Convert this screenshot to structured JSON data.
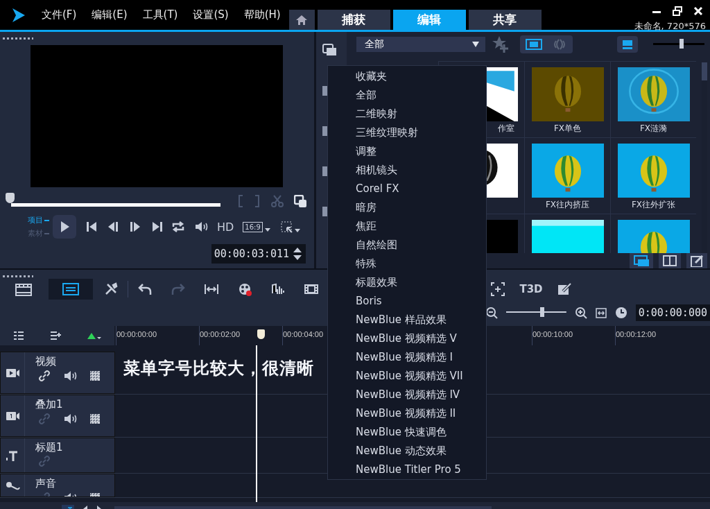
{
  "app_menu": [
    "文件(F)",
    "编辑(E)",
    "工具(T)",
    "设置(S)",
    "帮助(H)"
  ],
  "tabs": [
    {
      "kind": "home",
      "selected": false
    },
    {
      "kind": "text",
      "label": "捕获",
      "selected": false
    },
    {
      "kind": "text",
      "label": "编辑",
      "selected": true
    },
    {
      "kind": "text",
      "label": "共享",
      "selected": false
    }
  ],
  "project_info": "未命名, 720*576",
  "player": {
    "level": 0,
    "modes": [
      {
        "label": "项目",
        "selected": true
      },
      {
        "label": "素材",
        "selected": false
      }
    ],
    "quality": "HD",
    "aspect": "16:9",
    "timecode": "00:00:03:011"
  },
  "library": {
    "category": "全部",
    "zoom": {
      "level": 0.55
    },
    "items": [
      {
        "kind": "studio",
        "caption": "作室"
      },
      {
        "kind": "olive",
        "caption": "FX单色"
      },
      {
        "kind": "ripple",
        "caption": "FX涟漪"
      },
      {
        "kind": "mono"
      },
      {
        "kind": "sky",
        "caption": "FX往内挤压"
      },
      {
        "kind": "sky",
        "caption": "FX往外扩张"
      },
      {
        "kind": "dark"
      },
      {
        "kind": "cyan"
      },
      {
        "kind": "sky"
      }
    ]
  },
  "menu": {
    "items": [
      "收藏夹",
      "全部",
      "二维映射",
      "三维纹理映射",
      "调整",
      "相机镜头",
      "Corel FX",
      "暗房",
      "焦距",
      "自然绘图",
      "特殊",
      "标题效果",
      "Boris",
      "NewBlue 样品效果",
      "NewBlue 视频精选 V",
      "NewBlue 视频精选 I",
      "NewBlue 视频精选 VII",
      "NewBlue 视频精选 IV",
      "NewBlue 视频精选 II",
      "NewBlue 快速调色",
      "NewBlue 动态效果",
      "NewBlue Titler Pro 5"
    ]
  },
  "timeline": {
    "t3d_label": "T3D",
    "zoom": {
      "level": 0.6
    },
    "timecode": "0:00:00:000",
    "playhead": {
      "level": 0.246
    },
    "ruler_left": [
      "00:00:00:00",
      "00:00:02:00",
      "00:00:04:00"
    ],
    "ruler_right": [
      "00:00:10:00",
      "00:00:12:00"
    ],
    "tracks": [
      {
        "kind": "video",
        "name": "视频",
        "link_enabled": true
      },
      {
        "kind": "overlay",
        "name": "叠加1",
        "link_enabled": false
      },
      {
        "kind": "title",
        "name": "标题1",
        "link_enabled": false
      },
      {
        "kind": "voice",
        "name": "声音",
        "link_enabled": false
      }
    ]
  },
  "annotation": "菜单字号比较大，很清晰"
}
